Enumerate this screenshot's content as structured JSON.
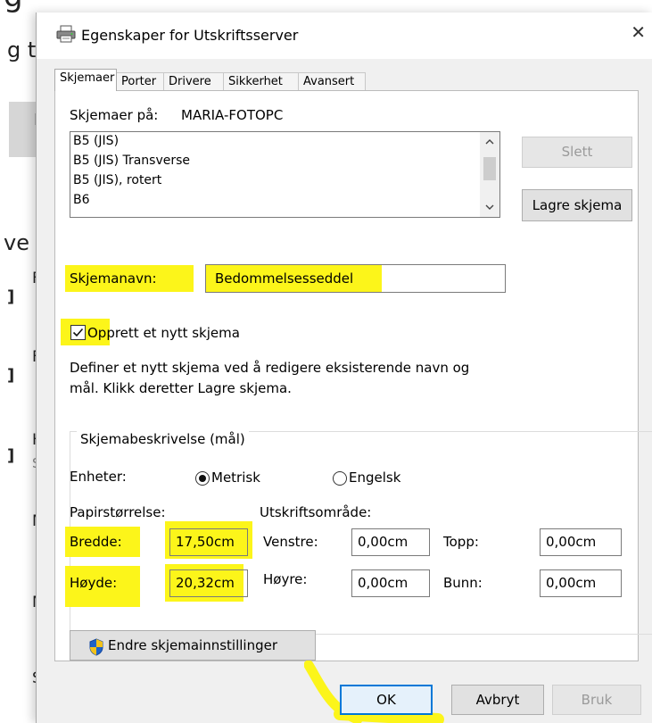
{
  "background": {
    "fragments": [
      "g t",
      "L",
      "ve",
      "F",
      "]",
      "F",
      "]",
      "H",
      "]",
      "S",
      "M",
      "M",
      "S"
    ]
  },
  "dialog": {
    "title": "Egenskaper for Utskriftsserver",
    "close_label": "✕",
    "tabs": [
      "Skjemaer",
      "Porter",
      "Drivere",
      "Sikkerhet",
      "Avansert"
    ],
    "active_tab": "Skjemaer",
    "forms_on_label": "Skjemaer på:",
    "forms_on_value": "MARIA-FOTOPC",
    "form_list": [
      "B5 (JIS)",
      "B5 (JIS) Transverse",
      "B5 (JIS), rotert",
      "B6"
    ],
    "delete_button": "Slett",
    "save_form_button": "Lagre skjema",
    "form_name_label": "Skjemanavn:",
    "form_name_value": "Bedommelsesseddel",
    "create_new_label": "Opprett et nytt skjema",
    "create_new_checked": true,
    "description": [
      "Definer et nytt skjema ved å redigere eksisterende navn og",
      "mål. Klikk deretter Lagre skjema."
    ],
    "group_title": "Skjemabeskrivelse (mål)",
    "units_label": "Enheter:",
    "unit_metric": "Metrisk",
    "unit_english": "Engelsk",
    "selected_unit": "Metrisk",
    "paper_size_label": "Papirstørrelse:",
    "print_area_label": "Utskriftsområde:",
    "width_label": "Bredde:",
    "width_value": "17,50cm",
    "height_label": "Høyde:",
    "height_value": "20,32cm",
    "left_label": "Venstre:",
    "left_value": "0,00cm",
    "top_label": "Topp:",
    "top_value": "0,00cm",
    "right_label": "Høyre:",
    "right_value": "0,00cm",
    "bottom_label": "Bunn:",
    "bottom_value": "0,00cm",
    "change_settings_button": "Endre skjemainnstillinger",
    "ok_button": "OK",
    "cancel_button": "Avbryt",
    "apply_button": "Bruk"
  },
  "colors": {
    "highlight": "#fcf51a",
    "shield_blue": "#1e63c8",
    "shield_yellow": "#f2c21b"
  },
  "icons": [
    "printer-icon",
    "close-icon",
    "shield-icon",
    "chevron-up-icon",
    "chevron-down-icon",
    "checkmark-icon"
  ]
}
